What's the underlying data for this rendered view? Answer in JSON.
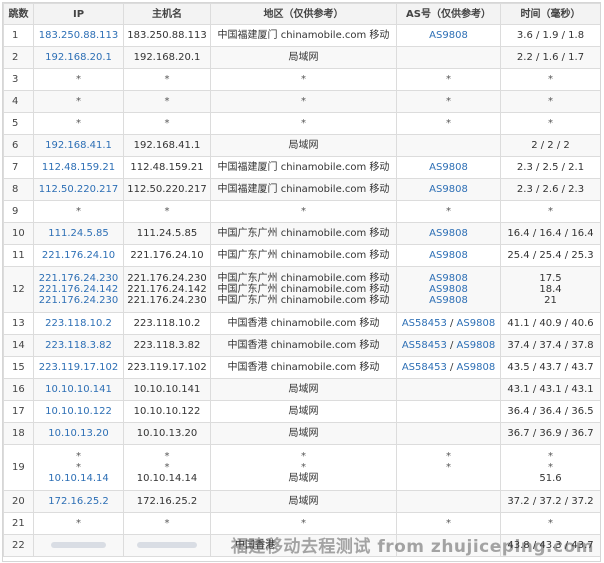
{
  "headers": [
    "跳数",
    "IP",
    "主机名",
    "地区（仅供参考）",
    "AS号（仅供参考）",
    "时间（毫秒）"
  ],
  "rows": [
    {
      "hop": "1",
      "ip": [
        "183.250.88.113"
      ],
      "host": [
        "183.250.88.113"
      ],
      "region": [
        "中国福建厦门 chinamobile.com 移动"
      ],
      "as": [
        [
          "AS9808"
        ]
      ],
      "time": [
        "3.6 / 1.9 / 1.8"
      ]
    },
    {
      "hop": "2",
      "ip": [
        "192.168.20.1"
      ],
      "host": [
        "192.168.20.1"
      ],
      "region": [
        "局域网"
      ],
      "as": [
        []
      ],
      "time": [
        "2.2 / 1.6 / 1.7"
      ]
    },
    {
      "hop": "3",
      "ip": [
        "*"
      ],
      "host": [
        "*"
      ],
      "region": [
        "*"
      ],
      "as": [
        [
          "*"
        ]
      ],
      "time": [
        "*"
      ]
    },
    {
      "hop": "4",
      "ip": [
        "*"
      ],
      "host": [
        "*"
      ],
      "region": [
        "*"
      ],
      "as": [
        [
          "*"
        ]
      ],
      "time": [
        "*"
      ]
    },
    {
      "hop": "5",
      "ip": [
        "*"
      ],
      "host": [
        "*"
      ],
      "region": [
        "*"
      ],
      "as": [
        [
          "*"
        ]
      ],
      "time": [
        "*"
      ]
    },
    {
      "hop": "6",
      "ip": [
        "192.168.41.1"
      ],
      "host": [
        "192.168.41.1"
      ],
      "region": [
        "局域网"
      ],
      "as": [
        []
      ],
      "time": [
        "2 / 2 / 2"
      ]
    },
    {
      "hop": "7",
      "ip": [
        "112.48.159.21"
      ],
      "host": [
        "112.48.159.21"
      ],
      "region": [
        "中国福建厦门 chinamobile.com 移动"
      ],
      "as": [
        [
          "AS9808"
        ]
      ],
      "time": [
        "2.3 / 2.5 / 2.1"
      ]
    },
    {
      "hop": "8",
      "ip": [
        "112.50.220.217"
      ],
      "host": [
        "112.50.220.217"
      ],
      "region": [
        "中国福建厦门 chinamobile.com 移动"
      ],
      "as": [
        [
          "AS9808"
        ]
      ],
      "time": [
        "2.3 / 2.6 / 2.3"
      ]
    },
    {
      "hop": "9",
      "ip": [
        "*"
      ],
      "host": [
        "*"
      ],
      "region": [
        "*"
      ],
      "as": [
        [
          "*"
        ]
      ],
      "time": [
        "*"
      ]
    },
    {
      "hop": "10",
      "ip": [
        "111.24.5.85"
      ],
      "host": [
        "111.24.5.85"
      ],
      "region": [
        "中国广东广州 chinamobile.com 移动"
      ],
      "as": [
        [
          "AS9808"
        ]
      ],
      "time": [
        "16.4 / 16.4 / 16.4"
      ]
    },
    {
      "hop": "11",
      "ip": [
        "221.176.24.10"
      ],
      "host": [
        "221.176.24.10"
      ],
      "region": [
        "中国广东广州 chinamobile.com 移动"
      ],
      "as": [
        [
          "AS9808"
        ]
      ],
      "time": [
        "25.4 / 25.4 / 25.3"
      ]
    },
    {
      "hop": "12",
      "ip": [
        "221.176.24.230",
        "221.176.24.142",
        "221.176.24.230"
      ],
      "host": [
        "221.176.24.230",
        "221.176.24.142",
        "221.176.24.230"
      ],
      "region": [
        "中国广东广州 chinamobile.com 移动",
        "中国广东广州 chinamobile.com 移动",
        "中国广东广州 chinamobile.com 移动"
      ],
      "as": [
        [
          "AS9808"
        ],
        [
          "AS9808"
        ],
        [
          "AS9808"
        ]
      ],
      "time": [
        "17.5",
        "18.4",
        "21"
      ]
    },
    {
      "hop": "13",
      "ip": [
        "223.118.10.2"
      ],
      "host": [
        "223.118.10.2"
      ],
      "region": [
        "中国香港 chinamobile.com 移动"
      ],
      "as": [
        [
          "AS58453",
          "AS9808"
        ]
      ],
      "time": [
        "41.1 / 40.9 / 40.6"
      ]
    },
    {
      "hop": "14",
      "ip": [
        "223.118.3.82"
      ],
      "host": [
        "223.118.3.82"
      ],
      "region": [
        "中国香港 chinamobile.com 移动"
      ],
      "as": [
        [
          "AS58453",
          "AS9808"
        ]
      ],
      "time": [
        "37.4 / 37.4 / 37.8"
      ]
    },
    {
      "hop": "15",
      "ip": [
        "223.119.17.102"
      ],
      "host": [
        "223.119.17.102"
      ],
      "region": [
        "中国香港 chinamobile.com 移动"
      ],
      "as": [
        [
          "AS58453",
          "AS9808"
        ]
      ],
      "time": [
        "43.5 / 43.7 / 43.7"
      ]
    },
    {
      "hop": "16",
      "ip": [
        "10.10.10.141"
      ],
      "host": [
        "10.10.10.141"
      ],
      "region": [
        "局域网"
      ],
      "as": [
        []
      ],
      "time": [
        "43.1 / 43.1 / 43.1"
      ]
    },
    {
      "hop": "17",
      "ip": [
        "10.10.10.122"
      ],
      "host": [
        "10.10.10.122"
      ],
      "region": [
        "局域网"
      ],
      "as": [
        []
      ],
      "time": [
        "36.4 / 36.4 / 36.5"
      ]
    },
    {
      "hop": "18",
      "ip": [
        "10.10.13.20"
      ],
      "host": [
        "10.10.13.20"
      ],
      "region": [
        "局域网"
      ],
      "as": [
        []
      ],
      "time": [
        "36.7 / 36.9 / 36.7"
      ]
    },
    {
      "hop": "19",
      "ip": [
        "*",
        "*",
        "10.10.14.14"
      ],
      "host": [
        "*",
        "*",
        "10.10.14.14"
      ],
      "region": [
        "*",
        "*",
        "局域网"
      ],
      "as": [
        [
          "*"
        ],
        [
          "*"
        ],
        []
      ],
      "time": [
        "*",
        "*",
        "51.6"
      ]
    },
    {
      "hop": "20",
      "ip": [
        "172.16.25.2"
      ],
      "host": [
        "172.16.25.2"
      ],
      "region": [
        "局域网"
      ],
      "as": [
        []
      ],
      "time": [
        "37.2 / 37.2 / 37.2"
      ]
    },
    {
      "hop": "21",
      "ip": [
        "*"
      ],
      "host": [
        "*"
      ],
      "region": [
        "*"
      ],
      "as": [
        [
          "*"
        ]
      ],
      "time": [
        "*"
      ]
    },
    {
      "hop": "22",
      "ip": [
        ""
      ],
      "host": [
        ""
      ],
      "region": [
        "中国香港"
      ],
      "as": [
        []
      ],
      "time": [
        "43.8 / 43.3 / 43.7"
      ]
    }
  ],
  "watermark": "福建移动去程测试 from zhujiceping.com"
}
